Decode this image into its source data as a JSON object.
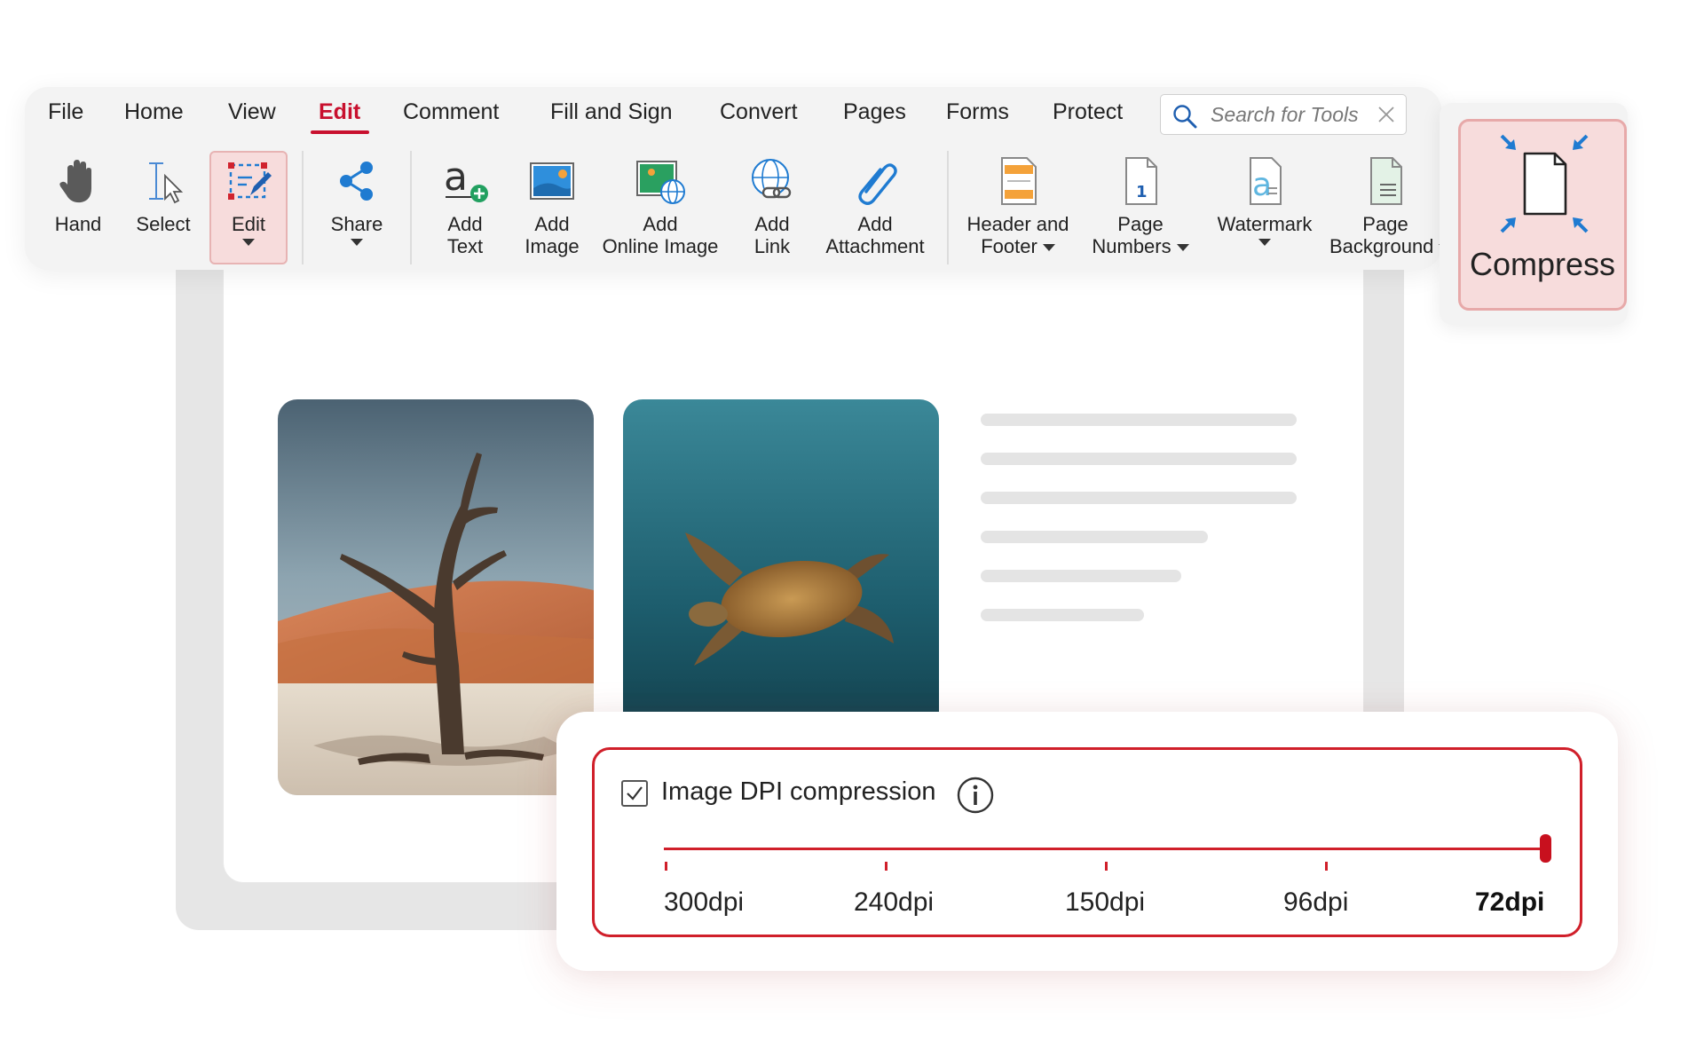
{
  "menu": {
    "tabs": [
      {
        "label": "File"
      },
      {
        "label": "Home"
      },
      {
        "label": "View"
      },
      {
        "label": "Edit"
      },
      {
        "label": "Comment"
      },
      {
        "label": "Fill and Sign"
      },
      {
        "label": "Convert"
      },
      {
        "label": "Pages"
      },
      {
        "label": "Forms"
      },
      {
        "label": "Protect"
      }
    ],
    "active_tab": "Edit"
  },
  "search": {
    "placeholder": "Search for Tools",
    "value": "",
    "icon": "magnifier-icon",
    "clear_icon": "close-icon"
  },
  "tools": {
    "hand": {
      "label": "Hand",
      "icon": "hand-icon"
    },
    "select": {
      "label": "Select",
      "icon": "text-cursor-icon"
    },
    "edit": {
      "label": "Edit",
      "icon": "edit-pen-icon"
    },
    "share": {
      "label": "Share",
      "icon": "share-icon"
    },
    "add_text": {
      "line1": "Add",
      "line2": "Text",
      "icon": "add-text-icon"
    },
    "add_image": {
      "line1": "Add",
      "line2": "Image",
      "icon": "image-icon"
    },
    "add_online_image": {
      "line1": "Add",
      "line2": "Online Image",
      "icon": "online-image-icon"
    },
    "add_link": {
      "line1": "Add",
      "line2": "Link",
      "icon": "link-globe-icon"
    },
    "add_attachment": {
      "line1": "Add",
      "line2": "Attachment",
      "icon": "paperclip-icon"
    },
    "header_footer": {
      "line1": "Header and",
      "line2": "Footer",
      "icon": "header-footer-icon"
    },
    "page_numbers": {
      "line1": "Page",
      "line2": "Numbers",
      "icon": "page-number-icon"
    },
    "watermark": {
      "label": "Watermark",
      "icon": "watermark-icon"
    },
    "page_background": {
      "line1": "Page",
      "line2": "Background",
      "icon": "page-background-icon"
    }
  },
  "compress": {
    "label": "Compress",
    "icon": "compress-icon"
  },
  "compression_panel": {
    "checkbox_label": "Image DPI compression",
    "checked": true,
    "dpi_options": [
      "300dpi",
      "240dpi",
      "150dpi",
      "96dpi",
      "72dpi"
    ],
    "selected_dpi": "72dpi",
    "accent_color": "#d01f2a"
  },
  "colors": {
    "accent": "#c8102e",
    "ribbon_background": "#f3f3f3",
    "highlight": "#f7dcdc",
    "icon_blue": "#1f7bd1"
  }
}
